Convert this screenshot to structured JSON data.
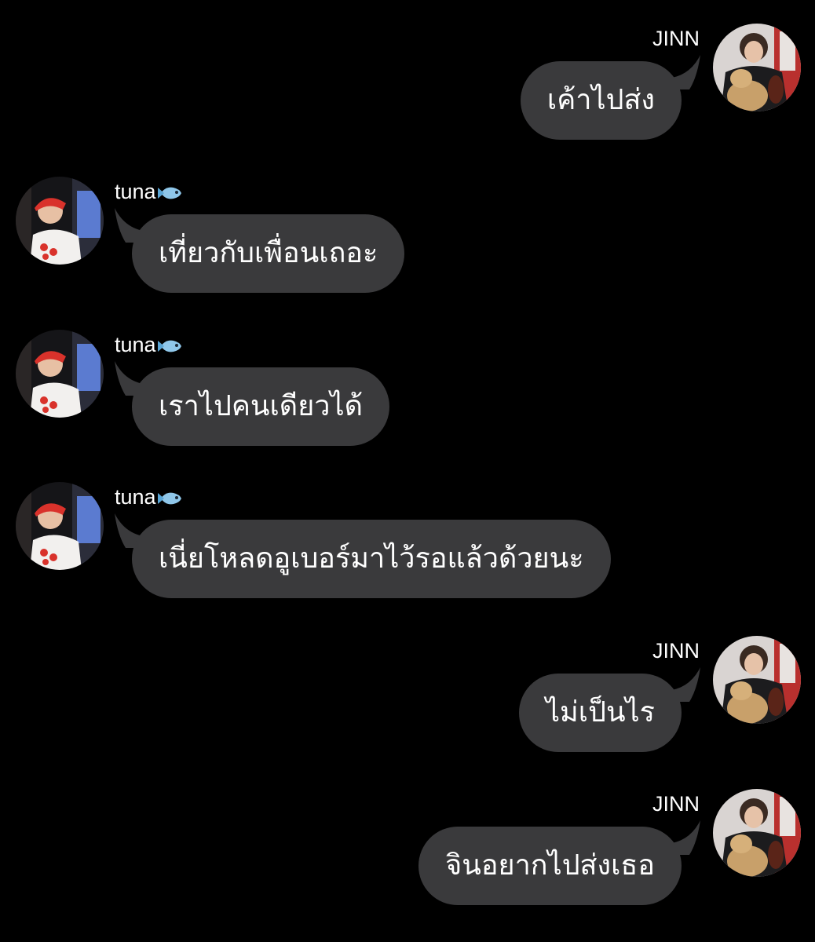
{
  "chat": {
    "messages": [
      {
        "side": "right",
        "sender": "JINN",
        "text": "เค้าไปส่ง"
      },
      {
        "side": "left",
        "sender": "tuna",
        "sender_emoji": "fish-emoji",
        "text": "เที่ยวกับเพื่อนเถอะ"
      },
      {
        "side": "left",
        "sender": "tuna",
        "sender_emoji": "fish-emoji",
        "text": "เราไปคนเดียวได้"
      },
      {
        "side": "left",
        "sender": "tuna",
        "sender_emoji": "fish-emoji",
        "text": "เนี่ยโหลดอูเบอร์มาไว้รอแล้วด้วยนะ"
      },
      {
        "side": "right",
        "sender": "JINN",
        "text": "ไม่เป็นไร"
      },
      {
        "side": "right",
        "sender": "JINN",
        "text": "จินอยากไปส่งเธอ"
      }
    ]
  },
  "colors": {
    "background": "#000000",
    "bubble": "#3a3a3c",
    "text": "#ffffff"
  }
}
